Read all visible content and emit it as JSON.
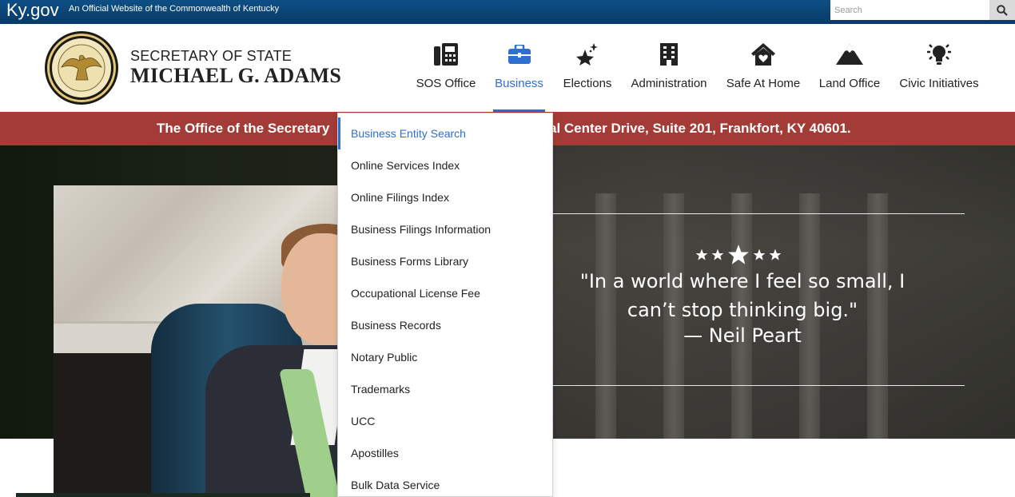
{
  "gov_bar": {
    "logo": "Ky.gov",
    "official_text": "An Official Website of the Commonwealth of Kentucky",
    "search_placeholder": "Search"
  },
  "header": {
    "brand_line1": "SECRETARY OF STATE",
    "brand_line2": "MICHAEL G. ADAMS",
    "seal_icon": "kentucky-seal-icon",
    "nav": [
      {
        "label": "SOS Office",
        "icon": "fax-icon"
      },
      {
        "label": "Business",
        "icon": "briefcase-icon",
        "active": true
      },
      {
        "label": "Elections",
        "icon": "star-sparkle-icon"
      },
      {
        "label": "Administration",
        "icon": "building-icon"
      },
      {
        "label": "Safe At Home",
        "icon": "house-heart-icon"
      },
      {
        "label": "Land Office",
        "icon": "mountain-icon"
      },
      {
        "label": "Civic Initiatives",
        "icon": "lightbulb-icon"
      }
    ]
  },
  "address_bar": {
    "left_text": "The Office of the Secretary",
    "right_text": "al Center Drive, Suite 201, Frankfort, KY 40601."
  },
  "hero": {
    "rating_stars": 5,
    "quote": "\"In a world where I feel so small, I can’t stop thinking big.\"",
    "author": "— Neil Peart"
  },
  "dropdown": {
    "items": [
      "Business Entity Search",
      "Online Services Index",
      "Online Filings Index",
      "Business Filings Information",
      "Business Forms Library",
      "Occupational License Fee",
      "Business Records",
      "Notary Public",
      "Trademarks",
      "UCC",
      "Apostilles",
      "Bulk Data Service"
    ],
    "active_index": 0
  },
  "colors": {
    "gov_bar": "#0b4576",
    "accent_blue": "#2f6fcf",
    "address_red": "#a33b36"
  }
}
